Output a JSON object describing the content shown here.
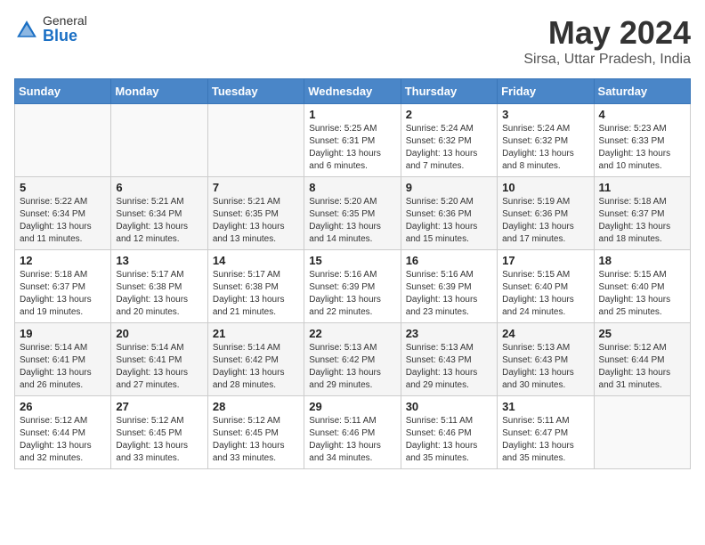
{
  "header": {
    "logo_general": "General",
    "logo_blue": "Blue",
    "main_title": "May 2024",
    "subtitle": "Sirsa, Uttar Pradesh, India"
  },
  "days_of_week": [
    "Sunday",
    "Monday",
    "Tuesday",
    "Wednesday",
    "Thursday",
    "Friday",
    "Saturday"
  ],
  "weeks": [
    [
      {
        "day": "",
        "info": ""
      },
      {
        "day": "",
        "info": ""
      },
      {
        "day": "",
        "info": ""
      },
      {
        "day": "1",
        "info": "Sunrise: 5:25 AM\nSunset: 6:31 PM\nDaylight: 13 hours and 6 minutes."
      },
      {
        "day": "2",
        "info": "Sunrise: 5:24 AM\nSunset: 6:32 PM\nDaylight: 13 hours and 7 minutes."
      },
      {
        "day": "3",
        "info": "Sunrise: 5:24 AM\nSunset: 6:32 PM\nDaylight: 13 hours and 8 minutes."
      },
      {
        "day": "4",
        "info": "Sunrise: 5:23 AM\nSunset: 6:33 PM\nDaylight: 13 hours and 10 minutes."
      }
    ],
    [
      {
        "day": "5",
        "info": "Sunrise: 5:22 AM\nSunset: 6:34 PM\nDaylight: 13 hours and 11 minutes."
      },
      {
        "day": "6",
        "info": "Sunrise: 5:21 AM\nSunset: 6:34 PM\nDaylight: 13 hours and 12 minutes."
      },
      {
        "day": "7",
        "info": "Sunrise: 5:21 AM\nSunset: 6:35 PM\nDaylight: 13 hours and 13 minutes."
      },
      {
        "day": "8",
        "info": "Sunrise: 5:20 AM\nSunset: 6:35 PM\nDaylight: 13 hours and 14 minutes."
      },
      {
        "day": "9",
        "info": "Sunrise: 5:20 AM\nSunset: 6:36 PM\nDaylight: 13 hours and 15 minutes."
      },
      {
        "day": "10",
        "info": "Sunrise: 5:19 AM\nSunset: 6:36 PM\nDaylight: 13 hours and 17 minutes."
      },
      {
        "day": "11",
        "info": "Sunrise: 5:18 AM\nSunset: 6:37 PM\nDaylight: 13 hours and 18 minutes."
      }
    ],
    [
      {
        "day": "12",
        "info": "Sunrise: 5:18 AM\nSunset: 6:37 PM\nDaylight: 13 hours and 19 minutes."
      },
      {
        "day": "13",
        "info": "Sunrise: 5:17 AM\nSunset: 6:38 PM\nDaylight: 13 hours and 20 minutes."
      },
      {
        "day": "14",
        "info": "Sunrise: 5:17 AM\nSunset: 6:38 PM\nDaylight: 13 hours and 21 minutes."
      },
      {
        "day": "15",
        "info": "Sunrise: 5:16 AM\nSunset: 6:39 PM\nDaylight: 13 hours and 22 minutes."
      },
      {
        "day": "16",
        "info": "Sunrise: 5:16 AM\nSunset: 6:39 PM\nDaylight: 13 hours and 23 minutes."
      },
      {
        "day": "17",
        "info": "Sunrise: 5:15 AM\nSunset: 6:40 PM\nDaylight: 13 hours and 24 minutes."
      },
      {
        "day": "18",
        "info": "Sunrise: 5:15 AM\nSunset: 6:40 PM\nDaylight: 13 hours and 25 minutes."
      }
    ],
    [
      {
        "day": "19",
        "info": "Sunrise: 5:14 AM\nSunset: 6:41 PM\nDaylight: 13 hours and 26 minutes."
      },
      {
        "day": "20",
        "info": "Sunrise: 5:14 AM\nSunset: 6:41 PM\nDaylight: 13 hours and 27 minutes."
      },
      {
        "day": "21",
        "info": "Sunrise: 5:14 AM\nSunset: 6:42 PM\nDaylight: 13 hours and 28 minutes."
      },
      {
        "day": "22",
        "info": "Sunrise: 5:13 AM\nSunset: 6:42 PM\nDaylight: 13 hours and 29 minutes."
      },
      {
        "day": "23",
        "info": "Sunrise: 5:13 AM\nSunset: 6:43 PM\nDaylight: 13 hours and 29 minutes."
      },
      {
        "day": "24",
        "info": "Sunrise: 5:13 AM\nSunset: 6:43 PM\nDaylight: 13 hours and 30 minutes."
      },
      {
        "day": "25",
        "info": "Sunrise: 5:12 AM\nSunset: 6:44 PM\nDaylight: 13 hours and 31 minutes."
      }
    ],
    [
      {
        "day": "26",
        "info": "Sunrise: 5:12 AM\nSunset: 6:44 PM\nDaylight: 13 hours and 32 minutes."
      },
      {
        "day": "27",
        "info": "Sunrise: 5:12 AM\nSunset: 6:45 PM\nDaylight: 13 hours and 33 minutes."
      },
      {
        "day": "28",
        "info": "Sunrise: 5:12 AM\nSunset: 6:45 PM\nDaylight: 13 hours and 33 minutes."
      },
      {
        "day": "29",
        "info": "Sunrise: 5:11 AM\nSunset: 6:46 PM\nDaylight: 13 hours and 34 minutes."
      },
      {
        "day": "30",
        "info": "Sunrise: 5:11 AM\nSunset: 6:46 PM\nDaylight: 13 hours and 35 minutes."
      },
      {
        "day": "31",
        "info": "Sunrise: 5:11 AM\nSunset: 6:47 PM\nDaylight: 13 hours and 35 minutes."
      },
      {
        "day": "",
        "info": ""
      }
    ]
  ]
}
